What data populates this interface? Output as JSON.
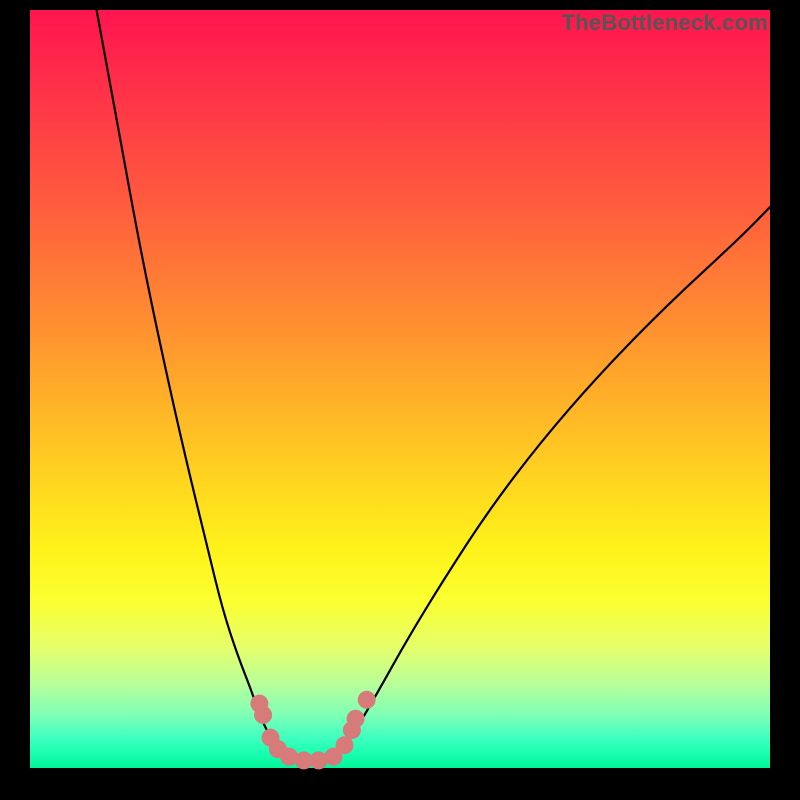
{
  "attribution": "TheBottleneck.com",
  "colors": {
    "background": "#000000",
    "gradient_top": "#ff154f",
    "gradient_bottom": "#00f59a",
    "curve": "#000000",
    "marker": "#d77a7a"
  },
  "chart_data": {
    "type": "line",
    "title": "",
    "xlabel": "",
    "ylabel": "",
    "xlim": [
      0,
      100
    ],
    "ylim": [
      0,
      100
    ],
    "series": [
      {
        "name": "left-curve",
        "x": [
          9,
          12,
          15,
          18,
          21,
          24,
          26,
          28,
          30,
          31,
          32,
          33,
          34
        ],
        "y": [
          100,
          84,
          68,
          54,
          41,
          29,
          21,
          15,
          10,
          7,
          5,
          3,
          2
        ]
      },
      {
        "name": "valley-floor",
        "x": [
          34,
          36,
          38,
          40,
          42
        ],
        "y": [
          2,
          1,
          1,
          1,
          2
        ]
      },
      {
        "name": "right-curve",
        "x": [
          42,
          44,
          47,
          51,
          56,
          62,
          69,
          77,
          86,
          96,
          100
        ],
        "y": [
          2,
          5,
          10,
          17,
          25,
          34,
          43,
          52,
          61,
          70,
          74
        ]
      }
    ],
    "markers": {
      "name": "highlighted-points",
      "points": [
        {
          "x": 31.0,
          "y": 8.5
        },
        {
          "x": 31.5,
          "y": 7.0
        },
        {
          "x": 32.5,
          "y": 4.0
        },
        {
          "x": 33.5,
          "y": 2.5
        },
        {
          "x": 35.0,
          "y": 1.5
        },
        {
          "x": 37.0,
          "y": 1.0
        },
        {
          "x": 39.0,
          "y": 1.0
        },
        {
          "x": 41.0,
          "y": 1.5
        },
        {
          "x": 42.5,
          "y": 3.0
        },
        {
          "x": 43.5,
          "y": 5.0
        },
        {
          "x": 44.0,
          "y": 6.5
        },
        {
          "x": 45.5,
          "y": 9.0
        }
      ],
      "radius": 9
    }
  }
}
